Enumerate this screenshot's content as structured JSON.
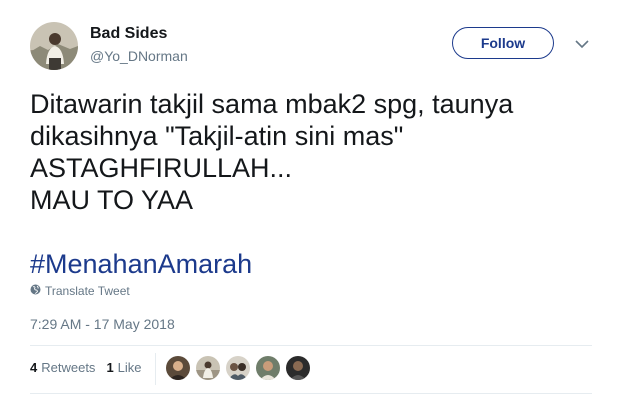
{
  "user": {
    "name": "Bad Sides",
    "handle": "@Yo_DNorman"
  },
  "follow_label": "Follow",
  "tweet": {
    "lines": [
      "Ditawarin takjil sama mbak2 spg, taunya",
      "dikasihnya \"Takjil-atin sini mas\"",
      "ASTAGHFIRULLAH...",
      "MAU TO YAA"
    ],
    "hashtag": "#MenahanAmarah"
  },
  "translate_label": "Translate Tweet",
  "timestamp": "7:29 AM - 17 May 2018",
  "stats": {
    "retweets_count": "4",
    "retweets_label": "Retweets",
    "likes_count": "1",
    "likes_label": "Like"
  },
  "colors": {
    "link": "#1c3a8c",
    "text": "#14171a",
    "secondary": "#657786",
    "divider": "#e6ecf0"
  },
  "icons": [
    "globe-icon",
    "chevron-down-icon"
  ]
}
